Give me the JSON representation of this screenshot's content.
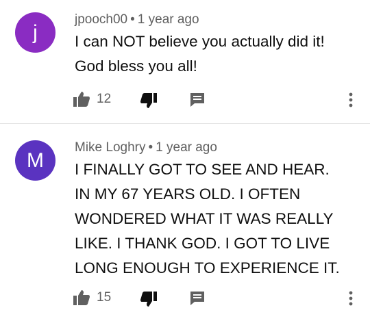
{
  "comments": [
    {
      "avatar_letter": "j",
      "avatar_color": "#8a2cc2",
      "author": "jpooch00",
      "separator": "•",
      "time": "1 year ago",
      "text": [
        "I can NOT believe you actually did it!",
        "God bless you all!"
      ],
      "likes": "12"
    },
    {
      "avatar_letter": "M",
      "avatar_color": "#5a33c0",
      "author": "Mike Loghry",
      "separator": "•",
      "time": "1 year ago",
      "text": [
        "I FINALLY GOT TO SEE AND HEAR.",
        "IN MY 67 YEARS OLD. I OFTEN",
        "WONDERED WHAT IT WAS REALLY",
        "LIKE. I THANK GOD. I GOT TO LIVE",
        "LONG ENOUGH TO EXPERIENCE IT."
      ],
      "likes": "15"
    }
  ],
  "icons": {
    "like": "thumbs-up-icon",
    "dislike": "thumbs-down-icon",
    "reply": "reply-comment-icon",
    "more": "more-vertical-icon"
  }
}
